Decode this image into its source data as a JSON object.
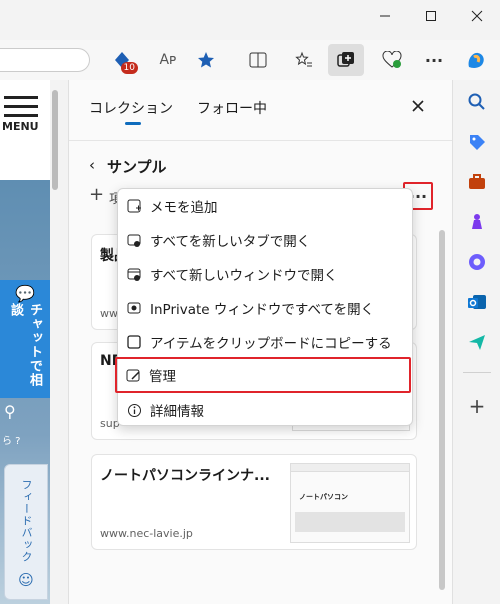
{
  "toolbar": {
    "badge_count": "10"
  },
  "page": {
    "menu_label": "MENU",
    "chat_label": "チャットで相談",
    "feedback_label": "フィードバック"
  },
  "panel": {
    "tabs": [
      "コレクション",
      "フォロー中"
    ],
    "collection_title": "サンプル",
    "add_label": "項",
    "cards": [
      {
        "title": "製品",
        "url": "www"
      },
      {
        "title": "NE",
        "url": "sup"
      },
      {
        "title": "ノートパソコンラインナ...",
        "url": "www.nec-lavie.jp",
        "thumb_heading": "ノートパソコン"
      }
    ]
  },
  "menu": {
    "items": [
      "メモを追加",
      "すべてを新しいタブで開く",
      "すべて新しいウィンドウで開く",
      "InPrivate ウィンドウですべてを開く",
      "アイテムをクリップボードにコピーする",
      "管理",
      "詳細情報"
    ]
  },
  "accent": "#0f6cbd",
  "highlight": "#e0242b"
}
